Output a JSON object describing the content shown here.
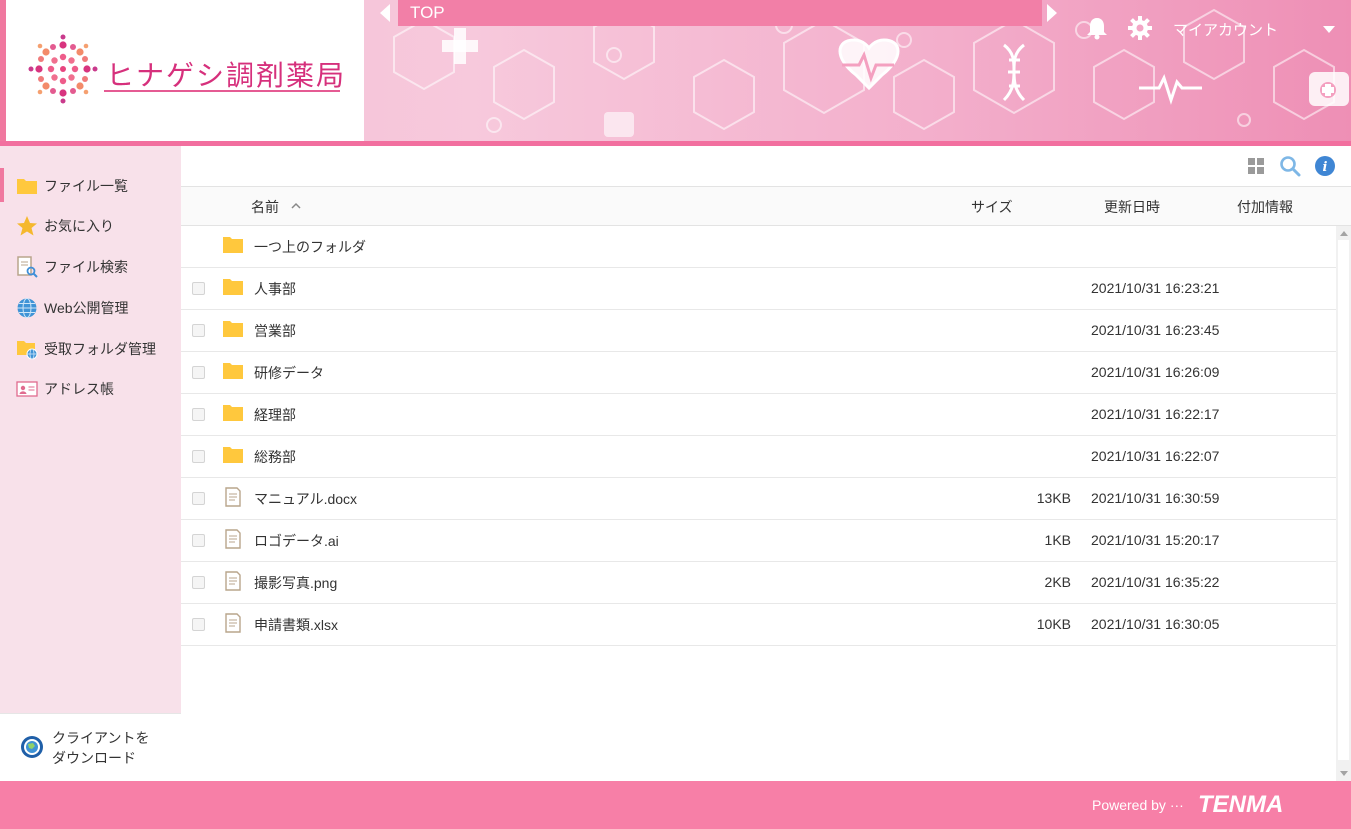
{
  "header": {
    "logo_text": "ヒナゲシ調剤薬局",
    "breadcrumb": "TOP",
    "account_label": "マイアカウント",
    "icons": {
      "notifications": "bell-icon",
      "settings": "gear-icon",
      "account_menu": "chevron-down-icon"
    }
  },
  "sidebar": {
    "items": [
      {
        "label": "ファイル一覧",
        "icon": "folder-icon",
        "active": true
      },
      {
        "label": "お気に入り",
        "icon": "star-icon"
      },
      {
        "label": "ファイル検索",
        "icon": "file-search-icon"
      },
      {
        "label": "Web公開管理",
        "icon": "globe-icon"
      },
      {
        "label": "受取フォルダ管理",
        "icon": "folder-globe-icon"
      },
      {
        "label": "アドレス帳",
        "icon": "address-card-icon"
      }
    ],
    "download_line1": "クライアントを",
    "download_line2": "ダウンロード"
  },
  "toolbar": {
    "icons": [
      "grid-view-icon",
      "search-icon",
      "info-icon"
    ]
  },
  "table": {
    "columns": {
      "name": "名前",
      "size": "サイズ",
      "modified": "更新日時",
      "extra": "付加情報"
    },
    "sort": {
      "column": "name",
      "direction": "asc"
    },
    "parent_folder": "一つ上のフォルダ",
    "rows": [
      {
        "name": "人事部",
        "type": "folder",
        "size": "",
        "modified": "2021/10/31 16:23:21"
      },
      {
        "name": "営業部",
        "type": "folder",
        "size": "",
        "modified": "2021/10/31 16:23:45"
      },
      {
        "name": "研修データ",
        "type": "folder",
        "size": "",
        "modified": "2021/10/31 16:26:09"
      },
      {
        "name": "経理部",
        "type": "folder",
        "size": "",
        "modified": "2021/10/31 16:22:17"
      },
      {
        "name": "総務部",
        "type": "folder",
        "size": "",
        "modified": "2021/10/31 16:22:07"
      },
      {
        "name": "マニュアル.docx",
        "type": "file",
        "size": "13KB",
        "modified": "2021/10/31 16:30:59"
      },
      {
        "name": "ロゴデータ.ai",
        "type": "file",
        "size": "1KB",
        "modified": "2021/10/31 15:20:17"
      },
      {
        "name": "撮影写真.png",
        "type": "file",
        "size": "2KB",
        "modified": "2021/10/31 16:35:22"
      },
      {
        "name": "申請書類.xlsx",
        "type": "file",
        "size": "10KB",
        "modified": "2021/10/31 16:30:05"
      }
    ]
  },
  "footer": {
    "powered_by": "Powered by ···",
    "brand": "TENMA"
  },
  "colors": {
    "accent": "#f77fa7",
    "logo": "#d6307c",
    "sidebar_bg": "#f8e1ea",
    "folder": "#ffc83d"
  }
}
